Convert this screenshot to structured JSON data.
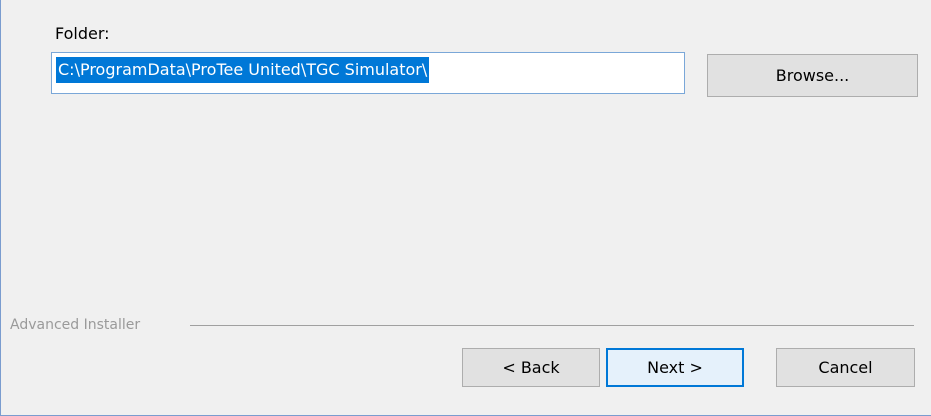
{
  "folder": {
    "label": "Folder:",
    "value": "C:\\ProgramData\\ProTee United\\TGC Simulator\\"
  },
  "buttons": {
    "browse": "Browse...",
    "back": "< Back",
    "next": "Next >",
    "cancel": "Cancel"
  },
  "footer": {
    "brand": "Advanced Installer"
  },
  "colors": {
    "window_bg": "#f0f0f0",
    "selection_bg": "#0078d7",
    "button_bg": "#e1e1e1",
    "default_button_border": "#0078d7"
  }
}
